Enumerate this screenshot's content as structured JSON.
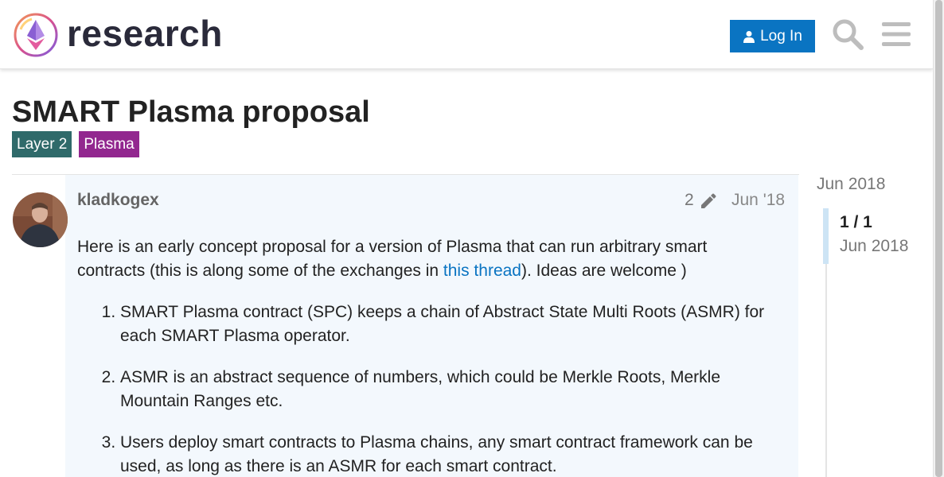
{
  "header": {
    "brand": "research",
    "login_label": "Log In"
  },
  "topic": {
    "title": "SMART Plasma proposal",
    "tags": [
      {
        "label": "Layer 2",
        "color": "#2f6a6a"
      },
      {
        "label": "Plasma",
        "color": "#92278f"
      }
    ]
  },
  "post": {
    "username": "kladkogex",
    "edit_count": "2",
    "date": "Jun '18",
    "intro_before_link": "Here is an early concept proposal for a version of Plasma that can run arbitrary smart contracts (this is along some of the exchanges in ",
    "link_text": "this thread",
    "intro_after_link": "). Ideas are welcome )",
    "list_items": [
      "SMART Plasma contract (SPC) keeps a chain of Abstract State Multi Roots (ASMR) for each SMART Plasma operator.",
      "ASMR is an abstract sequence of numbers, which could be Merkle Roots, Merkle Mountain Ranges etc.",
      "Users deploy smart contracts to Plasma chains, any smart contract framework can be used, as long as there is an ASMR for each smart contract."
    ]
  },
  "timeline": {
    "start_date": "Jun 2018",
    "position": "1 / 1",
    "current_date": "Jun 2018"
  },
  "colors": {
    "accent": "#0a74c2",
    "post_highlight": "#f3f8fd"
  },
  "icons": [
    "logo-icon",
    "user-icon",
    "search-icon",
    "hamburger-menu-icon",
    "pencil-icon"
  ]
}
